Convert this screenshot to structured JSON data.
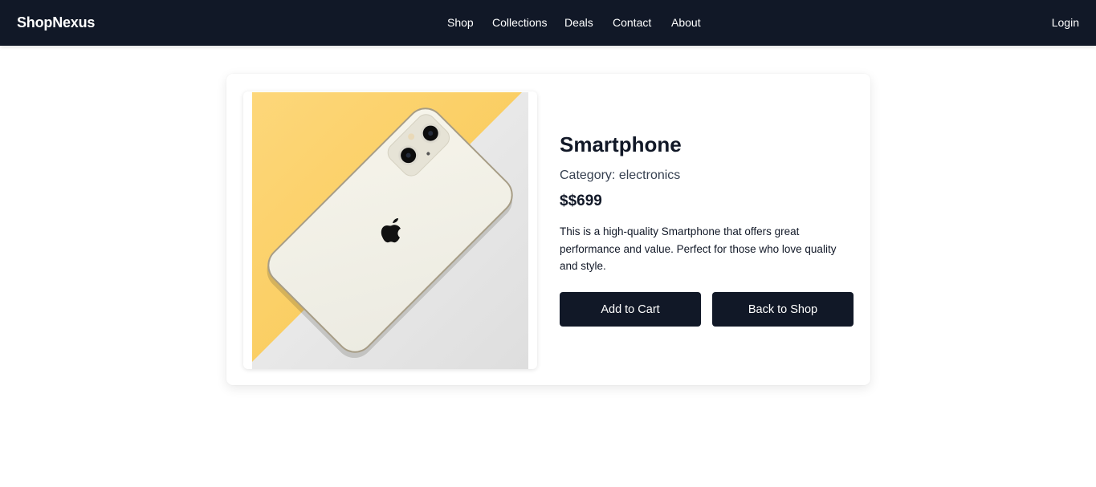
{
  "navbar": {
    "brand": "ShopNexus",
    "links": [
      {
        "label": "Shop"
      },
      {
        "label": "Collections"
      },
      {
        "label": "Deals"
      },
      {
        "label": "Contact"
      },
      {
        "label": "About"
      }
    ],
    "login_label": "Login"
  },
  "product": {
    "name": "Smartphone",
    "category_label": "Category:",
    "category": "electronics",
    "price": "$$699",
    "description": "This is a high-quality Smartphone that offers great performance and value. Perfect for those who love quality and style.",
    "image_icon": "smartphone-product-photo"
  },
  "actions": {
    "add_to_cart_label": "Add to Cart",
    "back_to_shop_label": "Back to Shop"
  },
  "colors": {
    "navbar_bg": "#111827",
    "button_bg": "#111827",
    "photo_yellow": "#fdd878",
    "photo_white": "#e9e9e9",
    "phone_body": "#f1efe4"
  }
}
